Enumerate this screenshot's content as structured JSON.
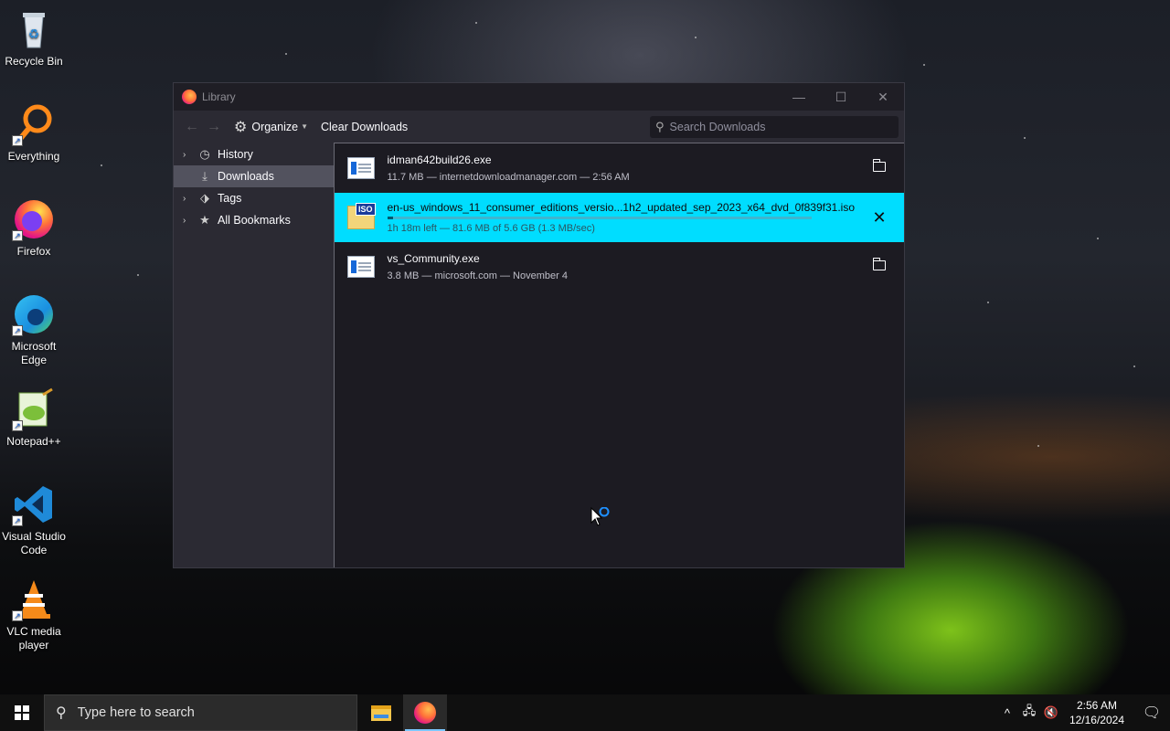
{
  "desktop": {
    "icons": [
      {
        "label": "Recycle Bin",
        "icon": "recycle-bin-icon"
      },
      {
        "label": "Everything",
        "icon": "everything-search-icon"
      },
      {
        "label": "Firefox",
        "icon": "firefox-icon"
      },
      {
        "label": "Microsoft Edge",
        "icon": "edge-icon"
      },
      {
        "label": "Notepad++",
        "icon": "notepadpp-icon"
      },
      {
        "label": "Visual Studio Code",
        "icon": "vscode-icon"
      },
      {
        "label": "VLC media player",
        "icon": "vlc-icon"
      }
    ]
  },
  "window": {
    "title": "Library",
    "controls": {
      "minimize": "—",
      "maximize": "☐",
      "close": "✕"
    }
  },
  "toolbar": {
    "back": "←",
    "forward": "→",
    "organize_label": "Organize",
    "clear_label": "Clear Downloads",
    "search_placeholder": "Search Downloads"
  },
  "sidebar": {
    "items": [
      {
        "label": "History",
        "icon": "clock-icon",
        "expandable": true,
        "selected": false
      },
      {
        "label": "Downloads",
        "icon": "download-icon",
        "expandable": false,
        "selected": true
      },
      {
        "label": "Tags",
        "icon": "tag-icon",
        "expandable": true,
        "selected": false
      },
      {
        "label": "All Bookmarks",
        "icon": "star-icon",
        "expandable": true,
        "selected": false
      }
    ]
  },
  "downloads": [
    {
      "name": "idman642build26.exe",
      "meta": "11.7 MB — internetdownloadmanager.com — 2:56 AM",
      "icon": "exe-file-icon",
      "action": "folder-icon",
      "active": false
    },
    {
      "name": "en-us_windows_11_consumer_editions_versio...1h2_updated_sep_2023_x64_dvd_0f839f31.iso",
      "meta": "1h 18m left — 81.6 MB of 5.6 GB (1.3 MB/sec)",
      "icon": "iso-file-icon",
      "iso_badge": "ISO",
      "action": "close-icon",
      "active": true,
      "progress": 0.015
    },
    {
      "name": "vs_Community.exe",
      "meta": "3.8 MB — microsoft.com — November 4",
      "icon": "exe-file-icon",
      "action": "folder-icon",
      "active": false
    }
  ],
  "taskbar": {
    "search_placeholder": "Type here to search",
    "apps": [
      {
        "name": "File Explorer",
        "icon": "file-explorer-icon",
        "active": false
      },
      {
        "name": "Firefox",
        "icon": "firefox-icon",
        "active": true
      }
    ],
    "tray": {
      "time": "2:56 AM",
      "date": "12/16/2024"
    }
  },
  "colors": {
    "accent_active_download": "#00ddff",
    "window_bg": "#2b2a33",
    "content_bg": "#1c1b22",
    "taskbar_bg": "#101010"
  }
}
